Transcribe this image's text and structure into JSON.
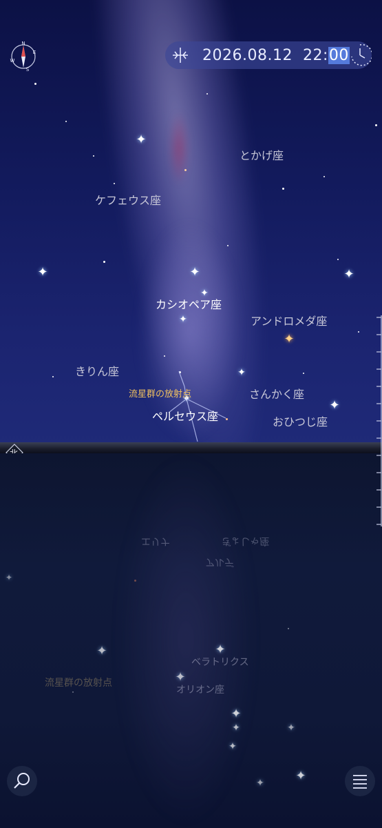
{
  "datetime": {
    "date": "2026.08.12",
    "hour": "22:",
    "minute": "00"
  },
  "compass_letters": {
    "n": "N",
    "e": "E",
    "s": "S",
    "w": "W"
  },
  "constellations": {
    "tokage": "とかげ座",
    "cepheus": "ケフェウス座",
    "cassiopeia": "カシオペア座",
    "andromeda": "アンドロメダ座",
    "camelopardalis": "きりん座",
    "triangulum": "さんかく座",
    "perseus": "ペルセウス座",
    "aries": "おひつじ座"
  },
  "radiant_label": "流星群の放射点",
  "north_marker": "北",
  "reflections": {
    "eridanus": "エリナ",
    "auriga": "ぎょしゃ座",
    "aldebaran": "アルデ",
    "bellatrix": "ベラトリクス",
    "radiant": "流星群の放射点",
    "orion": "オリオン座"
  },
  "colors": {
    "accent": "#5a82e6",
    "radiant": "#f0c060",
    "sky_top": "#0c1145",
    "sky_bottom": "#1f2a78"
  },
  "icons": {
    "compass": "compass-icon",
    "time": "time-reset-icon",
    "clock": "clock-icon",
    "search": "search-icon",
    "menu": "menu-icon"
  }
}
